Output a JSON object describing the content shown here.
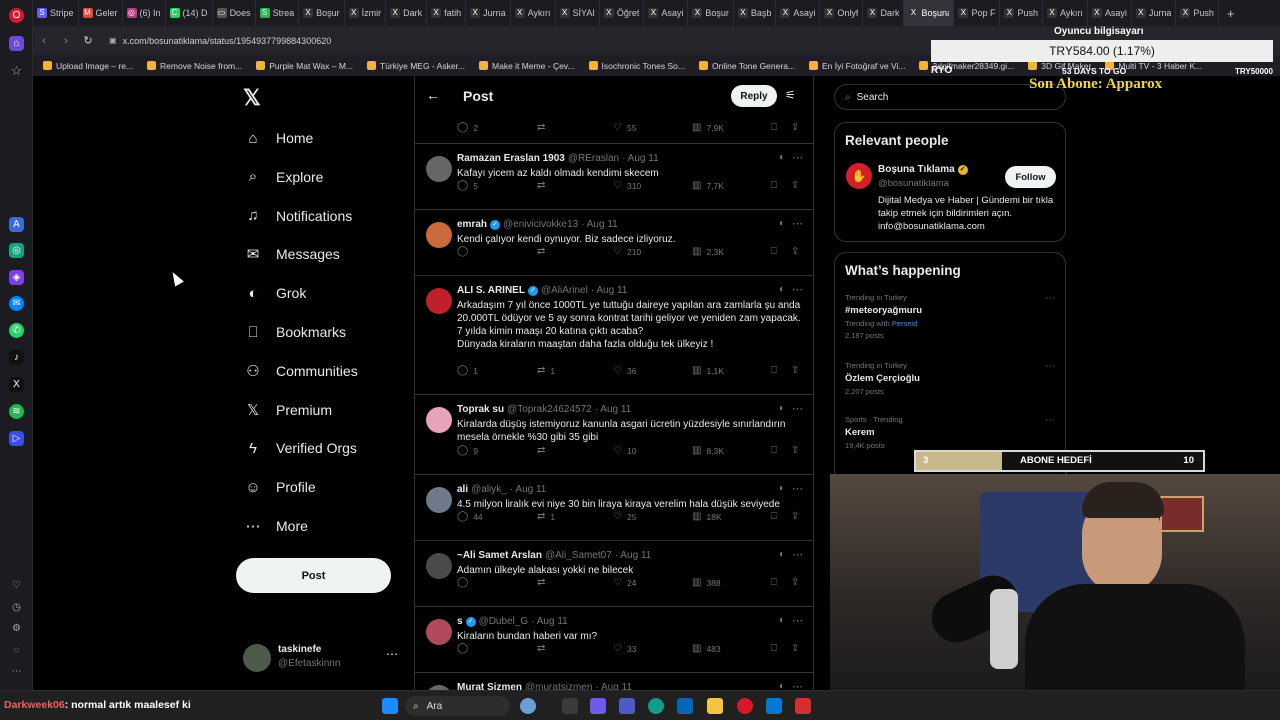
{
  "browser": {
    "tabs": [
      {
        "icon": "S",
        "label": "Stripe",
        "color": "#635bff"
      },
      {
        "icon": "M",
        "label": "Geler",
        "color": "#ea4335"
      },
      {
        "icon": "◎",
        "label": "(6) In",
        "color": "#c13584"
      },
      {
        "icon": "C",
        "label": "(14) D",
        "color": "#25d366"
      },
      {
        "icon": "▭",
        "label": "Does",
        "color": "#555555"
      },
      {
        "icon": "S",
        "label": "Strea",
        "color": "#1db954"
      },
      {
        "icon": "X",
        "label": "Boşur",
        "color": "#333333"
      },
      {
        "icon": "X",
        "label": "İzmir",
        "color": "#333333"
      },
      {
        "icon": "X",
        "label": "Dark",
        "color": "#333333"
      },
      {
        "icon": "X",
        "label": "fatih",
        "color": "#333333"
      },
      {
        "icon": "X",
        "label": "Jurna",
        "color": "#333333"
      },
      {
        "icon": "X",
        "label": "Aykırı",
        "color": "#333333"
      },
      {
        "icon": "X",
        "label": "SİYAI",
        "color": "#333333"
      },
      {
        "icon": "X",
        "label": "Öğret",
        "color": "#333333"
      },
      {
        "icon": "X",
        "label": "Asayi",
        "color": "#333333"
      },
      {
        "icon": "X",
        "label": "Boşur",
        "color": "#333333"
      },
      {
        "icon": "X",
        "label": "Başb",
        "color": "#333333"
      },
      {
        "icon": "X",
        "label": "Asayi",
        "color": "#333333"
      },
      {
        "icon": "X",
        "label": "Onlyf",
        "color": "#333333"
      },
      {
        "icon": "X",
        "label": "Dark",
        "color": "#333333"
      },
      {
        "icon": "X",
        "label": "Boşuna Tık",
        "color": "#333333",
        "active": true
      },
      {
        "icon": "X",
        "label": "Pop F",
        "color": "#333333"
      },
      {
        "icon": "X",
        "label": "Push",
        "color": "#333333"
      },
      {
        "icon": "X",
        "label": "Aykırı",
        "color": "#333333"
      },
      {
        "icon": "X",
        "label": "Asayi",
        "color": "#333333"
      },
      {
        "icon": "X",
        "label": "Jurna",
        "color": "#333333"
      },
      {
        "icon": "X",
        "label": "Push",
        "color": "#333333"
      }
    ],
    "url": "x.com/bosunatiklama/status/1954937799884300620",
    "bookmarks": [
      "Upload Image – re...",
      "Remove Noise from...",
      "Purple Mat Wax – M...",
      "Türkiye MEG - Asker...",
      "Make it Meme - Çev...",
      "Isochronic Tones So...",
      "Online Tone Genera...",
      "En İyi Fotoğraf ve Vi...",
      "3dgifmaker28349.gi...",
      "3D Gif Maker",
      "Multi TV - 3 Haber K..."
    ]
  },
  "nav": {
    "items": [
      "Home",
      "Explore",
      "Notifications",
      "Messages",
      "Grok",
      "Bookmarks",
      "Communities",
      "Premium",
      "Verified Orgs",
      "Profile",
      "More"
    ],
    "icons": [
      "house-icon",
      "magnifier-icon",
      "bell-icon",
      "envelope-icon",
      "grok-icon",
      "bookmark-icon",
      "people-icon",
      "x-premium-icon",
      "lightning-icon",
      "person-icon",
      "more-circle-icon"
    ],
    "post_label": "Post",
    "account": {
      "name": "taskinefe",
      "handle": "@Efetaskinnn"
    }
  },
  "header": {
    "title": "Post",
    "reply_label": "Reply"
  },
  "top_actions": {
    "replies": "2",
    "likes": "55",
    "views": "7,9K"
  },
  "tweets": [
    {
      "name": "Ramazan Eraslan 1903",
      "handle": "@REraslan",
      "date": "· Aug 11",
      "verified": false,
      "text": "Kafayı yicem az kaldı olmadı kendimi skecem",
      "replies": "5",
      "reposts": "",
      "likes": "310",
      "views": "7,7K",
      "avatar": "#666666"
    },
    {
      "name": "emrah",
      "handle": "@enivicivokke13",
      "date": "· Aug 11",
      "verified": true,
      "text": "Kendi çalıyor kendi oynuyor. Biz sadece izliyoruz.",
      "replies": "",
      "reposts": "",
      "likes": "210",
      "views": "2,3K",
      "avatar": "#c96a3d"
    },
    {
      "name": "ALI S. ARINEL",
      "handle": "@AliArinel",
      "date": "· Aug 11",
      "verified": true,
      "text": "Arkadaşım 7 yıl önce 1000TL ye tuttuğu daireye yapılan ara zamlarla şu anda 20.000TL ödüyor ve 5 ay sonra kontrat tarihi geliyor ve yeniden zam yapacak.\n7 yılda kimin maaşı 20 katına çıktı acaba?\nDünyada kiraların maaştan daha fazla olduğu tek ülkeyiz !",
      "replies": "1",
      "reposts": "1",
      "likes": "36",
      "views": "1,1K",
      "avatar": "#c0202a"
    },
    {
      "name": "Toprak su",
      "handle": "@Toprak24624572",
      "date": "· Aug 11",
      "verified": false,
      "text": "Kiralarda düşüş istemiyoruz kanunla asgari ücretin yüzdesiyle sınırlandırın mesela örnekle %30 gibi 35 gibi",
      "replies": "9",
      "reposts": "",
      "likes": "10",
      "views": "8,3K",
      "avatar": "#e8a3b8"
    },
    {
      "name": "ali",
      "handle": "@aliyk_",
      "date": "· Aug 11",
      "verified": false,
      "text": "4.5 milyon liralık evi niye 30 bin liraya kiraya verelim hala düşük seviyede",
      "replies": "44",
      "reposts": "1",
      "likes": "25",
      "views": "18K",
      "avatar": "#6c7a8a"
    },
    {
      "name": "~Ali Samet Arslan",
      "handle": "@Ali_Samet07",
      "date": "· Aug 11",
      "verified": false,
      "text": "Adamın ülkeyle alakası yokki ne bilecek",
      "replies": "",
      "reposts": "",
      "likes": "24",
      "views": "388",
      "avatar": "#4a4a4a"
    },
    {
      "name": "s",
      "handle": "@Dubel_G",
      "date": "· Aug 11",
      "verified": true,
      "text": "Kiraların bundan haberi var mı?",
      "replies": "",
      "reposts": "",
      "likes": "33",
      "views": "483",
      "avatar": "#b04a5a"
    },
    {
      "name": "Murat Sizmen",
      "handle": "@muratsizmen",
      "date": "· Aug 11",
      "verified": false,
      "text": "",
      "replies": "",
      "reposts": "",
      "likes": "",
      "views": "",
      "avatar": "#666666"
    }
  ],
  "sidebar": {
    "search_placeholder": "Search",
    "relevant_title": "Relevant people",
    "person": {
      "name": "Boşuna Tıklama",
      "handle": "@bosunatiklama",
      "bio": "Dijital Medya ve Haber | Gündemi bir tıkla takip etmek için bildirimleri açın. info@bosunatiklama.com",
      "follow_label": "Follow"
    },
    "happening_title": "What’s happening",
    "trends": [
      {
        "meta": "Trending in Turkey",
        "name": "#meteoryağmuru",
        "sub_prefix": "Trending with",
        "sub_link": "Perseid",
        "count": "2,187 posts"
      },
      {
        "meta": "Trending in Turkey",
        "name": "Özlem Çerçioğlu",
        "sub_prefix": "",
        "sub_link": "",
        "count": "2,207 posts"
      },
      {
        "meta": "Sports · Trending",
        "name": "Kerem",
        "sub_prefix": "",
        "sub_link": "",
        "count": "19,4K posts"
      }
    ]
  },
  "overlay": {
    "price": "TRY584.00 (1.17%)",
    "top_label": "Oyuncu bilgisayarı",
    "ryo": "RYO",
    "days": "53 DAYS TO GO",
    "target": "TRY50000",
    "last_sub": "Son Abone: Apparox",
    "goal_current": "3",
    "goal_label": "ABONE HEDEFİ",
    "goal_target": "10",
    "goal_progress": 0.3,
    "chat_user": "Darkweek06",
    "chat_message": ": normal artık maalesef ki"
  },
  "taskbar": {
    "search_label": "Ara"
  }
}
